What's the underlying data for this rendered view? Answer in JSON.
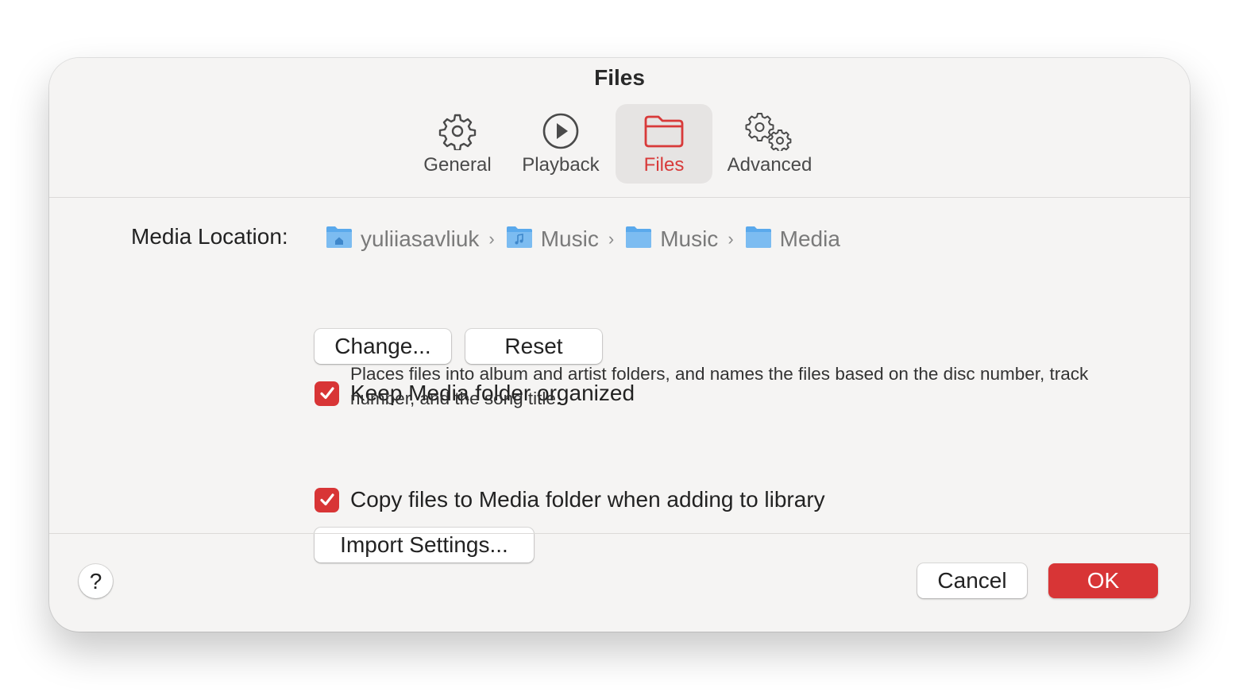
{
  "window": {
    "title": "Files"
  },
  "tabs": [
    {
      "label": "General",
      "icon": "gear-icon",
      "active": false
    },
    {
      "label": "Playback",
      "icon": "play-circle-icon",
      "active": false
    },
    {
      "label": "Files",
      "icon": "folder-icon",
      "active": true
    },
    {
      "label": "Advanced",
      "icon": "gears-icon",
      "active": false
    }
  ],
  "media_location": {
    "label": "Media Location:",
    "path": [
      {
        "name": "yuliiasavliuk",
        "icon": "home-folder-icon"
      },
      {
        "name": "Music",
        "icon": "music-folder-icon"
      },
      {
        "name": "Music",
        "icon": "folder-icon"
      },
      {
        "name": "Media",
        "icon": "folder-icon"
      }
    ],
    "separator": "›"
  },
  "buttons": {
    "change": "Change...",
    "reset": "Reset",
    "import_settings": "Import Settings..."
  },
  "options": {
    "keep_organized": {
      "label": "Keep Media folder organized",
      "checked": true,
      "description": "Places files into album and artist folders, and names the files based on the disc number, track number, and the song title."
    },
    "copy_files": {
      "label": "Copy files to Media folder when adding to library",
      "checked": true
    }
  },
  "footer": {
    "help": "?",
    "cancel": "Cancel",
    "ok": "OK"
  },
  "colors": {
    "accent": "#d83536",
    "background": "#f5f4f3",
    "folder_blue": "#5aa9ec"
  }
}
